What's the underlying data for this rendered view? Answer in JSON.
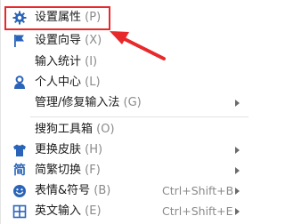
{
  "menu": {
    "items": [
      {
        "label": "设置属性",
        "key": "(P)",
        "icon": "gear-icon",
        "shortcut": "",
        "submenu": false
      },
      {
        "label": "设置向导",
        "key": "(X)",
        "icon": "flag-icon",
        "shortcut": "",
        "submenu": false
      },
      {
        "label": "输入统计",
        "key": "(I)",
        "icon": "",
        "shortcut": "",
        "submenu": false
      },
      {
        "label": "个人中心",
        "key": "(L)",
        "icon": "person-icon",
        "shortcut": "",
        "submenu": false
      },
      {
        "label": "管理/修复输入法",
        "key": "(G)",
        "icon": "",
        "shortcut": "",
        "submenu": true
      },
      {
        "label": "搜狗工具箱",
        "key": "(O)",
        "icon": "",
        "shortcut": "",
        "submenu": false
      },
      {
        "label": "更换皮肤",
        "key": "(H)",
        "icon": "shirt-icon",
        "shortcut": "",
        "submenu": true
      },
      {
        "label": "简繁切换",
        "key": "(F)",
        "icon": "simplified-traditional-icon",
        "glyph": "简",
        "shortcut": "",
        "submenu": true
      },
      {
        "label": "表情&符号",
        "key": "(B)",
        "icon": "smiley-icon",
        "shortcut": "Ctrl+Shift+B",
        "submenu": true
      },
      {
        "label": "英文输入",
        "key": "(E)",
        "icon": "english-input-icon",
        "shortcut": "Ctrl+Shift+E",
        "submenu": true
      }
    ]
  },
  "colors": {
    "accent": "#2a64b8",
    "highlight": "#e8292b",
    "text": "#1a1a1a",
    "muted": "#8a8a8a"
  }
}
